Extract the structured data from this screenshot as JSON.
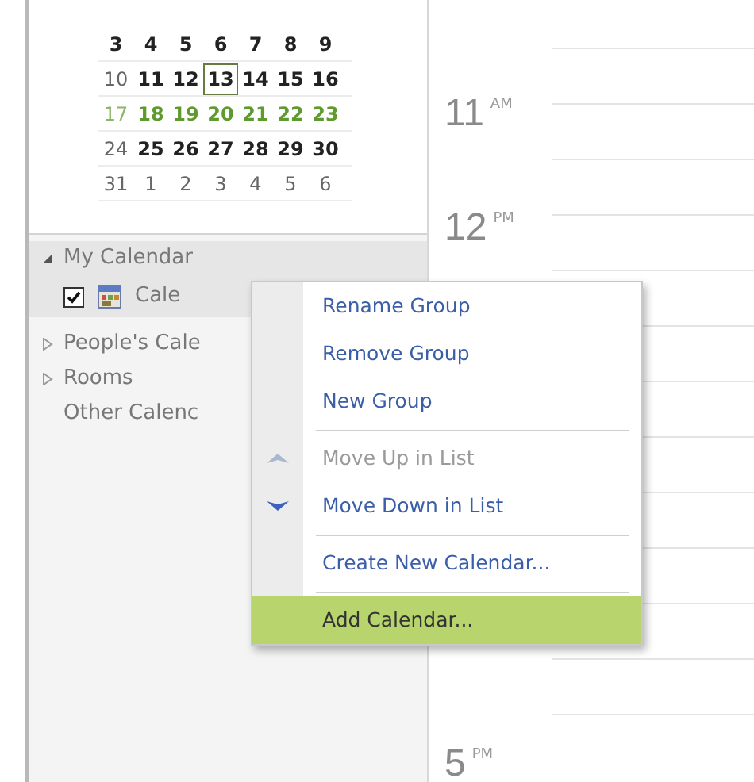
{
  "mini_calendar": {
    "weeks": [
      [
        {
          "day": "3",
          "bold": true,
          "current_week": false,
          "today": false
        },
        {
          "day": "4",
          "bold": true,
          "current_week": false,
          "today": false
        },
        {
          "day": "5",
          "bold": true,
          "current_week": false,
          "today": false
        },
        {
          "day": "6",
          "bold": true,
          "current_week": false,
          "today": false
        },
        {
          "day": "7",
          "bold": true,
          "current_week": false,
          "today": false
        },
        {
          "day": "8",
          "bold": true,
          "current_week": false,
          "today": false
        },
        {
          "day": "9",
          "bold": true,
          "current_week": false,
          "today": false
        }
      ],
      [
        {
          "day": "10",
          "bold": false,
          "current_week": false,
          "today": false
        },
        {
          "day": "11",
          "bold": true,
          "current_week": false,
          "today": false
        },
        {
          "day": "12",
          "bold": true,
          "current_week": false,
          "today": false
        },
        {
          "day": "13",
          "bold": true,
          "current_week": false,
          "today": true
        },
        {
          "day": "14",
          "bold": true,
          "current_week": false,
          "today": false
        },
        {
          "day": "15",
          "bold": true,
          "current_week": false,
          "today": false
        },
        {
          "day": "16",
          "bold": true,
          "current_week": false,
          "today": false
        }
      ],
      [
        {
          "day": "17",
          "bold": false,
          "current_week": true,
          "today": false
        },
        {
          "day": "18",
          "bold": true,
          "current_week": true,
          "today": false
        },
        {
          "day": "19",
          "bold": true,
          "current_week": true,
          "today": false
        },
        {
          "day": "20",
          "bold": true,
          "current_week": true,
          "today": false
        },
        {
          "day": "21",
          "bold": true,
          "current_week": true,
          "today": false
        },
        {
          "day": "22",
          "bold": true,
          "current_week": true,
          "today": false
        },
        {
          "day": "23",
          "bold": true,
          "current_week": true,
          "today": false
        }
      ],
      [
        {
          "day": "24",
          "bold": false,
          "current_week": false,
          "today": false
        },
        {
          "day": "25",
          "bold": true,
          "current_week": false,
          "today": false
        },
        {
          "day": "26",
          "bold": true,
          "current_week": false,
          "today": false
        },
        {
          "day": "27",
          "bold": true,
          "current_week": false,
          "today": false
        },
        {
          "day": "28",
          "bold": true,
          "current_week": false,
          "today": false
        },
        {
          "day": "29",
          "bold": true,
          "current_week": false,
          "today": false
        },
        {
          "day": "30",
          "bold": true,
          "current_week": false,
          "today": false
        }
      ],
      [
        {
          "day": "31",
          "bold": false,
          "current_week": false,
          "today": false
        },
        {
          "day": "1",
          "bold": false,
          "current_week": false,
          "today": false
        },
        {
          "day": "2",
          "bold": false,
          "current_week": false,
          "today": false
        },
        {
          "day": "3",
          "bold": false,
          "current_week": false,
          "today": false
        },
        {
          "day": "4",
          "bold": false,
          "current_week": false,
          "today": false
        },
        {
          "day": "5",
          "bold": false,
          "current_week": false,
          "today": false
        },
        {
          "day": "6",
          "bold": false,
          "current_week": false,
          "today": false
        }
      ]
    ]
  },
  "sidebar": {
    "groups": [
      {
        "label": "My Calendar",
        "expanded": true,
        "children": [
          {
            "label": "Cale",
            "checked": true
          }
        ]
      },
      {
        "label": "People's Cale",
        "expanded": false
      },
      {
        "label": "Rooms",
        "expanded": false
      },
      {
        "label": "Other Calenc"
      }
    ]
  },
  "day_view": {
    "times": [
      {
        "hour": "11",
        "period": "AM"
      },
      {
        "hour": "12",
        "period": "PM"
      },
      {
        "hour": "5",
        "period": "PM"
      }
    ]
  },
  "context_menu": {
    "items": [
      {
        "label": "Rename Group",
        "disabled": false,
        "selected": false,
        "separator_before": false
      },
      {
        "label": "Remove Group",
        "disabled": false,
        "selected": false,
        "separator_before": false
      },
      {
        "label": "New Group",
        "disabled": false,
        "selected": false,
        "separator_before": false
      },
      {
        "label": "Move Up in List",
        "disabled": true,
        "selected": false,
        "separator_before": true,
        "kind": "move_up"
      },
      {
        "label": "Move Down in List",
        "disabled": false,
        "selected": false,
        "separator_before": false,
        "kind": "move_down"
      },
      {
        "label": "Create New Calendar...",
        "disabled": false,
        "selected": false,
        "separator_before": true
      },
      {
        "label": "Add Calendar...",
        "disabled": false,
        "selected": true,
        "separator_before": true
      }
    ]
  }
}
